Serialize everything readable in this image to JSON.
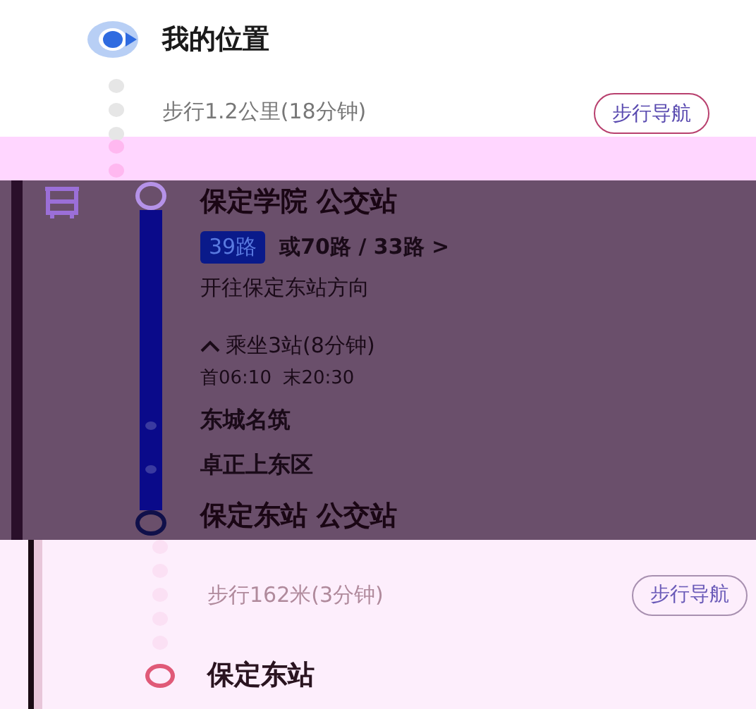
{
  "steps": [
    {
      "kind": "origin",
      "name": "我的位置"
    },
    {
      "kind": "walk",
      "text": "步行1.2公里(18分钟)",
      "button": "步行导航"
    },
    {
      "kind": "bus",
      "board_stop": "保定学院 公交站",
      "line": "39路",
      "alternatives": "或70路 / 33路 >",
      "direction": "开往保定东站方向",
      "ride": {
        "text": "乘坐3站(8分钟)",
        "expanded": true
      },
      "hours": "首06:10  末20:30",
      "stops": [
        "东城名筑",
        "卓正上东区"
      ],
      "alight_stop": "保定东站 公交站"
    },
    {
      "kind": "walk",
      "text": "步行162米(3分钟)",
      "button": "步行导航"
    },
    {
      "kind": "destination",
      "name": "保定东站"
    }
  ]
}
